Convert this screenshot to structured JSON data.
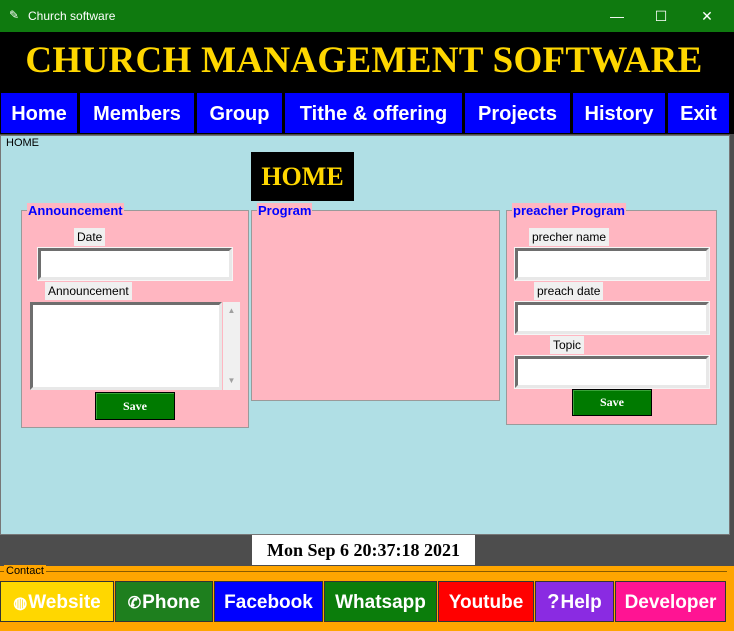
{
  "window": {
    "title": "Church software",
    "app_icon": "feather-icon",
    "minimize_glyph": "—",
    "maximize_glyph": "☐",
    "close_glyph": "✕"
  },
  "banner": {
    "title": "CHURCH MANAGEMENT SOFTWARE"
  },
  "nav": {
    "items": [
      {
        "label": "Home"
      },
      {
        "label": "Members"
      },
      {
        "label": "Group"
      },
      {
        "label": "Tithe & offering"
      },
      {
        "label": "Projects"
      },
      {
        "label": "History"
      },
      {
        "label": "Exit"
      }
    ]
  },
  "home": {
    "frame_label": "HOME",
    "heading": "HOME",
    "announcement": {
      "panel_label": "Announcement",
      "date_label": "Date",
      "date_value": "",
      "announcement_label": "Announcement",
      "announcement_value": "",
      "save_label": "Save"
    },
    "program": {
      "panel_label": "Program"
    },
    "preacher": {
      "panel_label": "preacher Program",
      "name_label": "precher name",
      "name_value": "",
      "date_label": "preach date",
      "date_value": "",
      "topic_label": "Topic",
      "topic_value": "",
      "save_label": "Save"
    }
  },
  "clock": {
    "text": "Mon Sep  6 20:37:18 2021"
  },
  "contact": {
    "frame_label": "Contact",
    "buttons": [
      {
        "label": "Website",
        "icon": "globe-icon",
        "glyph": "◍",
        "color": "#ffd700"
      },
      {
        "label": "Phone",
        "icon": "phone-icon",
        "glyph": "✆",
        "color": "#1e7f1e"
      },
      {
        "label": "Facebook",
        "icon": "",
        "glyph": "",
        "color": "#0000ff"
      },
      {
        "label": "Whatsapp",
        "icon": "",
        "glyph": "",
        "color": "#0b7d0b"
      },
      {
        "label": "Youtube",
        "icon": "",
        "glyph": "",
        "color": "#ff0000"
      },
      {
        "label": "Help",
        "icon": "help-icon",
        "glyph": "?",
        "color": "#8a2be2"
      },
      {
        "label": "Developer",
        "icon": "",
        "glyph": "",
        "color": "#ff1493"
      }
    ]
  },
  "colors": {
    "titlebar": "#0f7a0f",
    "banner_text": "#ffd700",
    "nav_button": "#0000ff",
    "content_bg": "#b0dfe5",
    "panel_bg": "#ffb6c1",
    "save_button": "#007a00",
    "contact_bg": "#ffa500"
  }
}
